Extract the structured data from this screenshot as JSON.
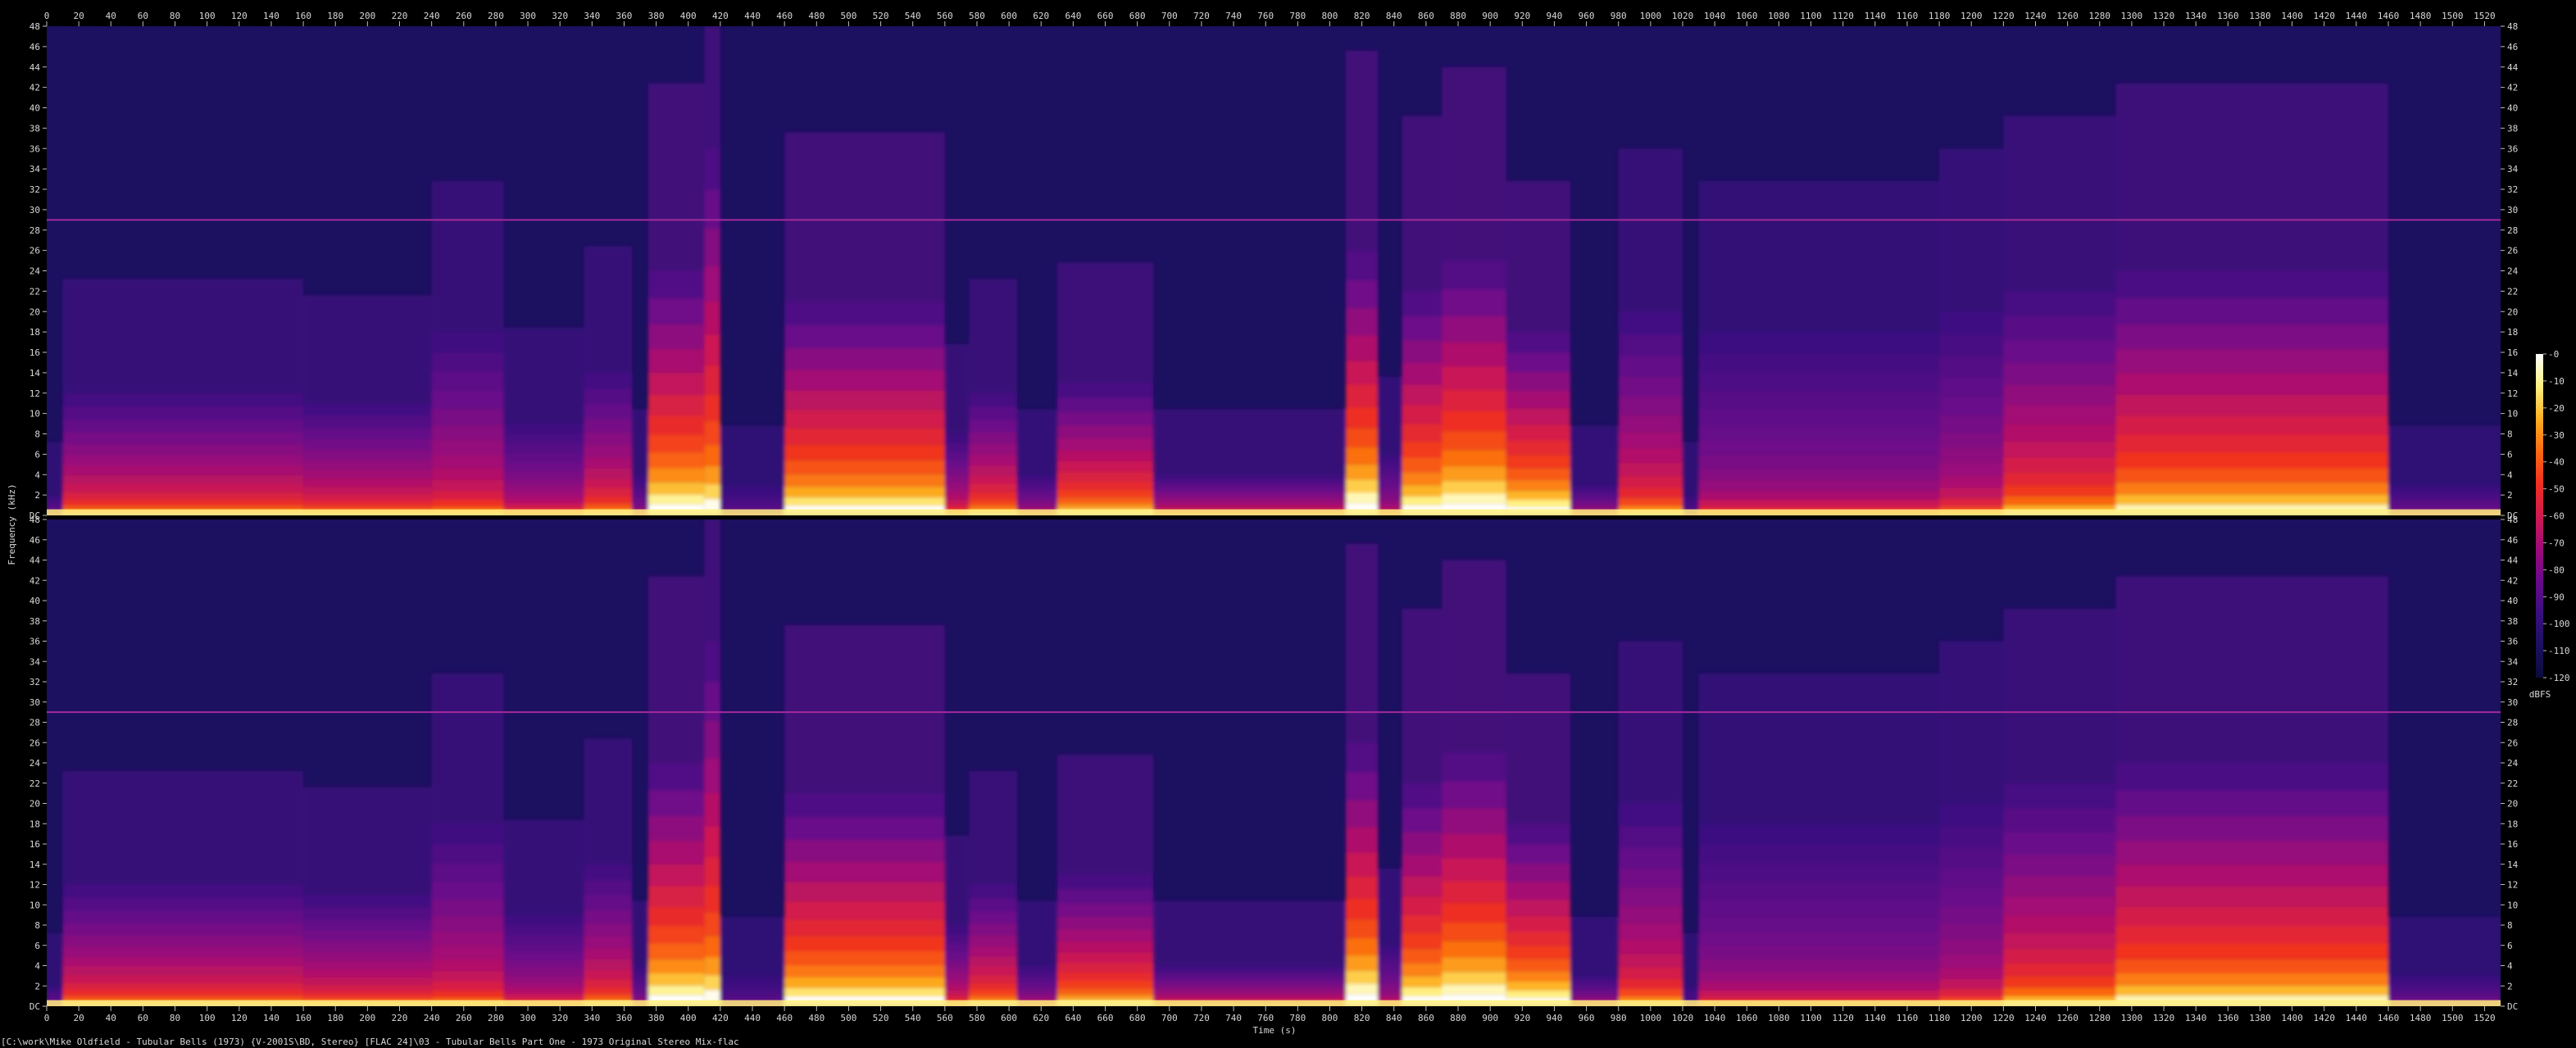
{
  "chart_data": {
    "type": "heatmap",
    "subtype": "spectrogram",
    "channels": 2,
    "x": {
      "label": "Time (s)",
      "range": [
        0,
        1530
      ],
      "ticks": [
        0,
        20,
        40,
        60,
        80,
        100,
        120,
        140,
        160,
        180,
        200,
        220,
        240,
        260,
        280,
        300,
        320,
        340,
        360,
        380,
        400,
        420,
        440,
        460,
        480,
        500,
        520,
        540,
        560,
        580,
        600,
        620,
        640,
        660,
        680,
        700,
        720,
        740,
        760,
        780,
        800,
        820,
        840,
        860,
        880,
        900,
        920,
        940,
        960,
        980,
        1000,
        1020,
        1040,
        1060,
        1080,
        1100,
        1120,
        1140,
        1160,
        1180,
        1200,
        1220,
        1240,
        1260,
        1280,
        1300,
        1320,
        1340,
        1360,
        1380,
        1400,
        1420,
        1440,
        1460,
        1480,
        1500,
        1520
      ]
    },
    "y": {
      "label": "Frequency (kHz)",
      "range": [
        0,
        48
      ],
      "ticks": [
        48,
        46,
        44,
        42,
        40,
        38,
        36,
        34,
        32,
        30,
        28,
        26,
        24,
        22,
        20,
        18,
        16,
        14,
        12,
        10,
        8,
        6,
        4,
        2,
        0
      ],
      "bottom_label": "DC"
    },
    "colorbar": {
      "unit": "dBFS",
      "range": [
        -120,
        0
      ],
      "ticks": [
        "-0",
        "-10",
        "-20",
        "-30",
        "-40",
        "-50",
        "-60",
        "-70",
        "-80",
        "-90",
        "-100",
        "-110",
        "-120"
      ],
      "colormap": [
        "#0b0c3a",
        "#1c1060",
        "#3a0f80",
        "#6a0a8a",
        "#a00a78",
        "#d01a50",
        "#f03020",
        "#fb6a10",
        "#fdb020",
        "#fff080",
        "#ffffff"
      ]
    },
    "reference_line_khz": 29,
    "segments": [
      {
        "t0": 0,
        "t1": 10,
        "hi_khz": 2,
        "level": 0.35
      },
      {
        "t0": 10,
        "t1": 160,
        "hi_khz": 12,
        "level": 0.62
      },
      {
        "t0": 160,
        "t1": 240,
        "hi_khz": 11,
        "level": 0.6
      },
      {
        "t0": 240,
        "t1": 285,
        "hi_khz": 18,
        "level": 0.55
      },
      {
        "t0": 285,
        "t1": 335,
        "hi_khz": 9,
        "level": 0.5
      },
      {
        "t0": 335,
        "t1": 365,
        "hi_khz": 14,
        "level": 0.62
      },
      {
        "t0": 365,
        "t1": 375,
        "hi_khz": 4,
        "level": 0.4
      },
      {
        "t0": 375,
        "t1": 410,
        "hi_khz": 24,
        "level": 0.92
      },
      {
        "t0": 410,
        "t1": 420,
        "hi_khz": 36,
        "level": 0.85
      },
      {
        "t0": 420,
        "t1": 460,
        "hi_khz": 3,
        "level": 0.3
      },
      {
        "t0": 460,
        "t1": 560,
        "hi_khz": 21,
        "level": 0.88
      },
      {
        "t0": 560,
        "t1": 575,
        "hi_khz": 8,
        "level": 0.55
      },
      {
        "t0": 575,
        "t1": 605,
        "hi_khz": 12,
        "level": 0.68
      },
      {
        "t0": 605,
        "t1": 630,
        "hi_khz": 4,
        "level": 0.45
      },
      {
        "t0": 630,
        "t1": 690,
        "hi_khz": 13,
        "level": 0.75
      },
      {
        "t0": 690,
        "t1": 810,
        "hi_khz": 4,
        "level": 0.55
      },
      {
        "t0": 810,
        "t1": 830,
        "hi_khz": 26,
        "level": 0.95
      },
      {
        "t0": 830,
        "t1": 845,
        "hi_khz": 6,
        "level": 0.45
      },
      {
        "t0": 845,
        "t1": 870,
        "hi_khz": 22,
        "level": 0.9
      },
      {
        "t0": 870,
        "t1": 910,
        "hi_khz": 25,
        "level": 0.95
      },
      {
        "t0": 910,
        "t1": 950,
        "hi_khz": 18,
        "level": 0.9
      },
      {
        "t0": 950,
        "t1": 980,
        "hi_khz": 3,
        "level": 0.45
      },
      {
        "t0": 980,
        "t1": 1020,
        "hi_khz": 20,
        "level": 0.6
      },
      {
        "t0": 1020,
        "t1": 1030,
        "hi_khz": 2,
        "level": 0.3
      },
      {
        "t0": 1030,
        "t1": 1180,
        "hi_khz": 18,
        "level": 0.42
      },
      {
        "t0": 1180,
        "t1": 1220,
        "hi_khz": 20,
        "level": 0.48
      },
      {
        "t0": 1220,
        "t1": 1290,
        "hi_khz": 22,
        "level": 0.66
      },
      {
        "t0": 1290,
        "t1": 1460,
        "hi_khz": 24,
        "level": 0.8
      },
      {
        "t0": 1460,
        "t1": 1530,
        "hi_khz": 3,
        "level": 0.35
      }
    ]
  },
  "file_label": "[C:\\work\\Mike Oldfield - Tubular Bells (1973) {V-2001S\\BD, Stereo} [FLAC 24]\\03 - Tubular Bells Part One - 1973 Original Stereo Mix-flac"
}
